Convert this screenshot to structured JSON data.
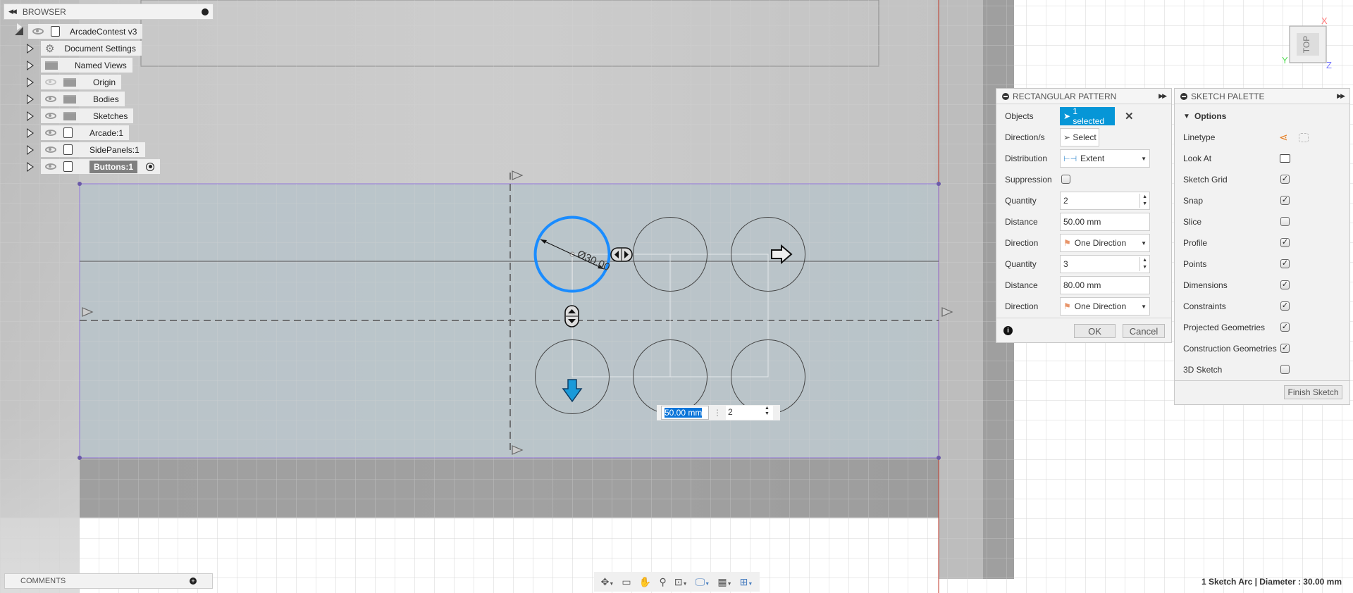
{
  "browser": {
    "title": "BROWSER",
    "items": [
      {
        "label": "ArcadeContest v3",
        "icon": "component-icon",
        "eye": "visible"
      },
      {
        "label": "Document Settings",
        "icon": "gear-icon"
      },
      {
        "label": "Named Views",
        "icon": "folder-icon"
      },
      {
        "label": "Origin",
        "icon": "folder-icon",
        "eye": "hidden"
      },
      {
        "label": "Bodies",
        "icon": "folder-icon",
        "eye": "visible"
      },
      {
        "label": "Sketches",
        "icon": "folder-icon",
        "eye": "visible"
      },
      {
        "label": "Arcade:1",
        "icon": "body-icon",
        "eye": "visible"
      },
      {
        "label": "SidePanels:1",
        "icon": "body-icon",
        "eye": "visible"
      },
      {
        "label": "Buttons:1",
        "icon": "body-icon",
        "eye": "visible",
        "active": true
      }
    ]
  },
  "comments": {
    "title": "COMMENTS"
  },
  "viewcube": {
    "face": "TOP",
    "x": "X",
    "y": "Y",
    "z": "Z"
  },
  "sketch": {
    "dimension": "Ø30.00",
    "inline_distance": "50.00 mm",
    "inline_quantity": "2",
    "selected_color": "#1a8cff"
  },
  "pattern": {
    "title": "RECTANGULAR PATTERN",
    "rows": [
      {
        "label": "Objects",
        "value": "1 selected"
      },
      {
        "label": "Direction/s",
        "value": "Select"
      },
      {
        "label": "Distribution",
        "value": "Extent"
      },
      {
        "label": "Suppression",
        "checked": false
      },
      {
        "label": "Quantity",
        "value": "2"
      },
      {
        "label": "Distance",
        "value": "50.00 mm"
      },
      {
        "label": "Direction",
        "value": "One Direction"
      },
      {
        "label": "Quantity",
        "value": "3"
      },
      {
        "label": "Distance",
        "value": "80.00 mm"
      },
      {
        "label": "Direction",
        "value": "One Direction"
      }
    ],
    "ok": "OK",
    "cancel": "Cancel"
  },
  "palette": {
    "title": "SKETCH PALETTE",
    "section": "Options",
    "linetype": "Linetype",
    "look_at": "Look At",
    "options": [
      {
        "label": "Sketch Grid",
        "checked": true
      },
      {
        "label": "Snap",
        "checked": true
      },
      {
        "label": "Slice",
        "checked": false
      },
      {
        "label": "Profile",
        "checked": true
      },
      {
        "label": "Points",
        "checked": true
      },
      {
        "label": "Dimensions",
        "checked": true
      },
      {
        "label": "Constraints",
        "checked": true
      },
      {
        "label": "Projected Geometries",
        "checked": true
      },
      {
        "label": "Construction Geometries",
        "checked": true
      },
      {
        "label": "3D Sketch",
        "checked": false
      }
    ],
    "finish": "Finish Sketch"
  },
  "toolbar": [
    "orbit-icon",
    "look-at-icon",
    "pan-icon",
    "zoom-icon",
    "fit-icon",
    "display-settings-icon",
    "grid-icon",
    "viewports-icon"
  ],
  "status": "1 Sketch Arc | Diameter : 30.00 mm"
}
